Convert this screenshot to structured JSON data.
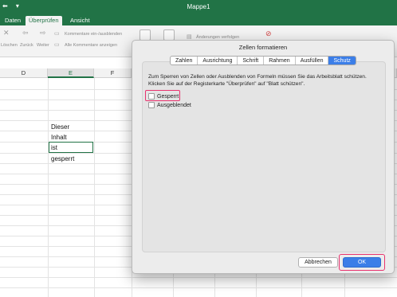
{
  "window": {
    "title": "Mappe1",
    "quick_access": "⬅ ▾"
  },
  "ribbon_tabs": [
    {
      "label": "Daten"
    },
    {
      "label": "Überprüfen"
    },
    {
      "label": "Ansicht"
    }
  ],
  "ribbon": {
    "delete_label": "Löschen",
    "back_label": "Zurück",
    "next_label": "Weiter",
    "show_hide_comments": "Kommentare ein-/ausblenden",
    "show_all_comments": "Alle Kommentare anzeigen",
    "track_changes": "Änderungen verfolgen"
  },
  "sheet": {
    "columns": [
      "D",
      "E",
      "F"
    ],
    "cells": [
      "Dieser",
      "Inhalt",
      "ist",
      "gesperrt"
    ]
  },
  "dialog": {
    "title": "Zellen formatieren",
    "tabs": [
      "Zahlen",
      "Ausrichtung",
      "Schrift",
      "Rahmen",
      "Ausfüllen",
      "Schutz"
    ],
    "active_tab": "Schutz",
    "description": "Zum Sperren von Zellen oder Ausblenden von Formeln müssen Sie das Arbeitsblatt schützen. Klicken Sie auf der Registerkarte \"Überprüfen\" auf \"Blatt schützen\".",
    "checkbox_locked": "Gesperrt",
    "checkbox_hidden": "Ausgeblendet",
    "cancel_label": "Abbrechen",
    "ok_label": "OK"
  },
  "colors": {
    "excel_green": "#217346",
    "accent_blue": "#3b7ee8",
    "highlight": "#e8326e"
  }
}
